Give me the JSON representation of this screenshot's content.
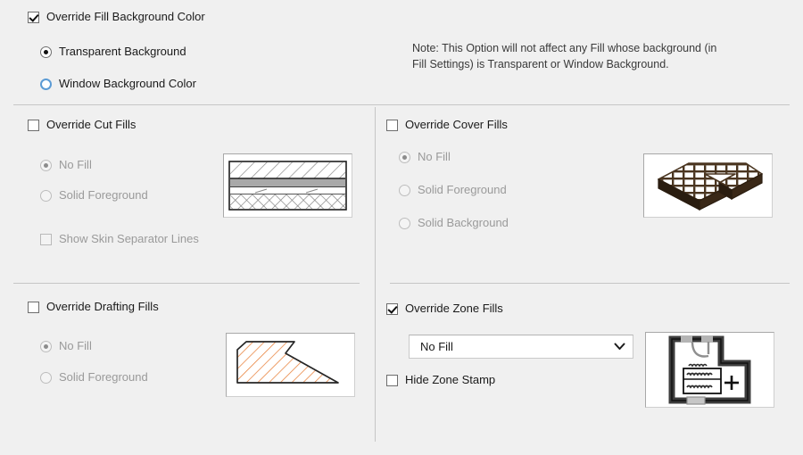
{
  "theme": {
    "bg": "#f0f0f0",
    "text": "#1a1a1a",
    "disabled_text": "#9a9a9a",
    "divider": "#c6c6c6",
    "accent_blue": "#5b9bd5",
    "hatch_orange": "#e8803a",
    "cover_brown": "#4a3520"
  },
  "override_background": {
    "checkbox_label": "Override Fill Background Color",
    "checked": true,
    "options": [
      {
        "label": "Transparent Background",
        "selected": true
      },
      {
        "label": "Window Background Color",
        "selected": false
      }
    ],
    "note": "Note: This Option will not affect any Fill whose background (in Fill Settings) is Transparent or Window Background."
  },
  "cut_fills": {
    "checkbox_label": "Override Cut Fills",
    "checked": false,
    "options": [
      {
        "label": "No Fill",
        "selected": true
      },
      {
        "label": "Solid Foreground",
        "selected": false
      }
    ],
    "extra_checkbox": {
      "label": "Show Skin Separator Lines",
      "checked": false
    },
    "preview_name": "wall-section-preview"
  },
  "cover_fills": {
    "checkbox_label": "Override Cover Fills",
    "checked": false,
    "options": [
      {
        "label": "No Fill",
        "selected": true
      },
      {
        "label": "Solid Foreground",
        "selected": false
      },
      {
        "label": "Solid Background",
        "selected": false
      }
    ],
    "preview_name": "isometric-slab-preview"
  },
  "drafting_fills": {
    "checkbox_label": "Override Drafting Fills",
    "checked": false,
    "options": [
      {
        "label": "No Fill",
        "selected": true
      },
      {
        "label": "Solid Foreground",
        "selected": false
      }
    ],
    "preview_name": "hatched-polygon-preview"
  },
  "zone_fills": {
    "checkbox_label": "Override Zone Fills",
    "checked": true,
    "dropdown": {
      "value": "No Fill",
      "icon": "chevron-down-icon"
    },
    "extra_checkbox": {
      "label": "Hide Zone Stamp",
      "checked": false
    },
    "preview_name": "zone-stamp-preview"
  }
}
